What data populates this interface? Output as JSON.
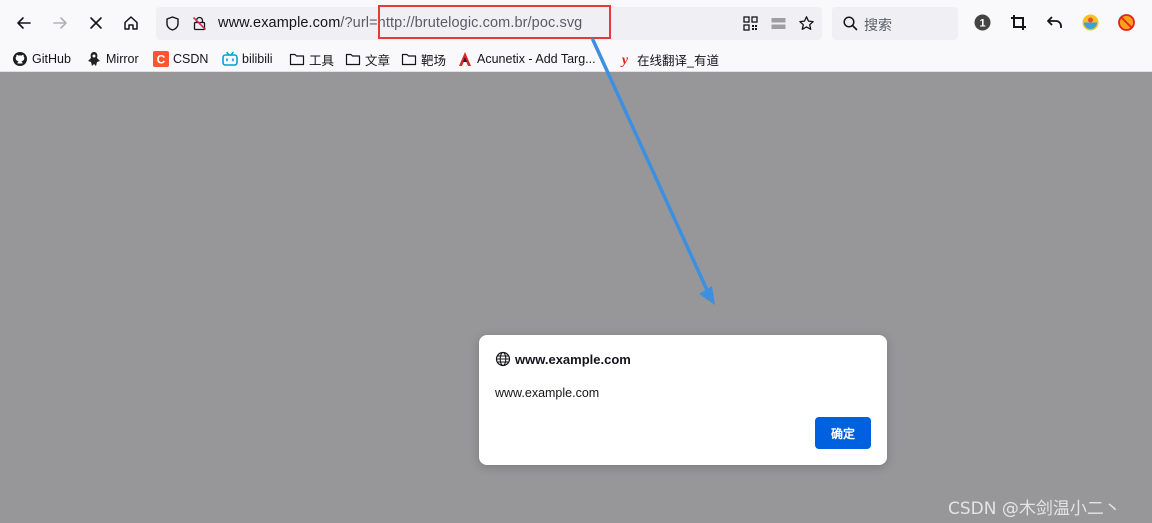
{
  "browser": {
    "url_host": "www.example.com",
    "url_path": "/?url=",
    "url_param": "http://brutelogic.com.br/poc.svg",
    "search_placeholder": "搜索",
    "notification_count": "1"
  },
  "bookmarks": [
    {
      "label": "GitHub",
      "icon": "github-icon"
    },
    {
      "label": "Mirror",
      "icon": "mirror-icon"
    },
    {
      "label": "CSDN",
      "icon": "csdn-icon"
    },
    {
      "label": "bilibili",
      "icon": "bilibili-icon"
    },
    {
      "label": "工具",
      "icon": "folder-icon"
    },
    {
      "label": "文章",
      "icon": "folder-icon"
    },
    {
      "label": "靶场",
      "icon": "folder-icon"
    },
    {
      "label": "Acunetix - Add Targ...",
      "icon": "acunetix-icon"
    },
    {
      "label": "在线翻译_有道",
      "icon": "youdao-icon"
    }
  ],
  "dialog": {
    "title": "www.example.com",
    "message": "www.example.com",
    "ok_label": "确定"
  },
  "watermark": "CSDN @木剑温小二丶",
  "colors": {
    "highlight_box": "#e8393a",
    "annotation_arrow": "#3d8fe0",
    "primary_button": "#0061e0",
    "overlay": "#97979a"
  }
}
